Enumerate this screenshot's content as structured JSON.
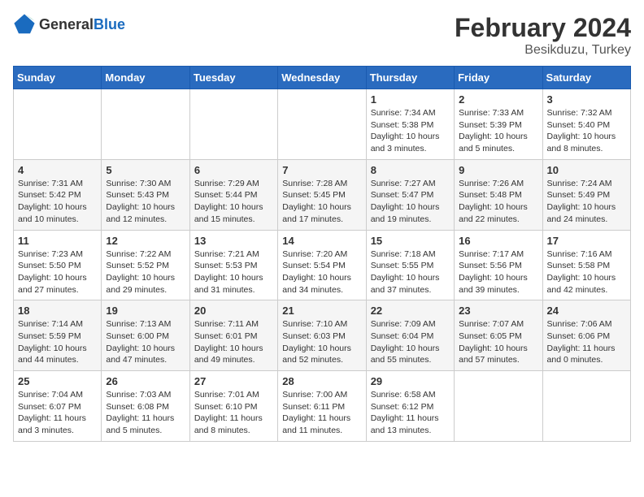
{
  "logo": {
    "general": "General",
    "blue": "Blue"
  },
  "header": {
    "month": "February 2024",
    "location": "Besikduzu, Turkey"
  },
  "weekdays": [
    "Sunday",
    "Monday",
    "Tuesday",
    "Wednesday",
    "Thursday",
    "Friday",
    "Saturday"
  ],
  "weeks": [
    [
      {
        "day": "",
        "info": ""
      },
      {
        "day": "",
        "info": ""
      },
      {
        "day": "",
        "info": ""
      },
      {
        "day": "",
        "info": ""
      },
      {
        "day": "1",
        "info": "Sunrise: 7:34 AM\nSunset: 5:38 PM\nDaylight: 10 hours\nand 3 minutes."
      },
      {
        "day": "2",
        "info": "Sunrise: 7:33 AM\nSunset: 5:39 PM\nDaylight: 10 hours\nand 5 minutes."
      },
      {
        "day": "3",
        "info": "Sunrise: 7:32 AM\nSunset: 5:40 PM\nDaylight: 10 hours\nand 8 minutes."
      }
    ],
    [
      {
        "day": "4",
        "info": "Sunrise: 7:31 AM\nSunset: 5:42 PM\nDaylight: 10 hours\nand 10 minutes."
      },
      {
        "day": "5",
        "info": "Sunrise: 7:30 AM\nSunset: 5:43 PM\nDaylight: 10 hours\nand 12 minutes."
      },
      {
        "day": "6",
        "info": "Sunrise: 7:29 AM\nSunset: 5:44 PM\nDaylight: 10 hours\nand 15 minutes."
      },
      {
        "day": "7",
        "info": "Sunrise: 7:28 AM\nSunset: 5:45 PM\nDaylight: 10 hours\nand 17 minutes."
      },
      {
        "day": "8",
        "info": "Sunrise: 7:27 AM\nSunset: 5:47 PM\nDaylight: 10 hours\nand 19 minutes."
      },
      {
        "day": "9",
        "info": "Sunrise: 7:26 AM\nSunset: 5:48 PM\nDaylight: 10 hours\nand 22 minutes."
      },
      {
        "day": "10",
        "info": "Sunrise: 7:24 AM\nSunset: 5:49 PM\nDaylight: 10 hours\nand 24 minutes."
      }
    ],
    [
      {
        "day": "11",
        "info": "Sunrise: 7:23 AM\nSunset: 5:50 PM\nDaylight: 10 hours\nand 27 minutes."
      },
      {
        "day": "12",
        "info": "Sunrise: 7:22 AM\nSunset: 5:52 PM\nDaylight: 10 hours\nand 29 minutes."
      },
      {
        "day": "13",
        "info": "Sunrise: 7:21 AM\nSunset: 5:53 PM\nDaylight: 10 hours\nand 31 minutes."
      },
      {
        "day": "14",
        "info": "Sunrise: 7:20 AM\nSunset: 5:54 PM\nDaylight: 10 hours\nand 34 minutes."
      },
      {
        "day": "15",
        "info": "Sunrise: 7:18 AM\nSunset: 5:55 PM\nDaylight: 10 hours\nand 37 minutes."
      },
      {
        "day": "16",
        "info": "Sunrise: 7:17 AM\nSunset: 5:56 PM\nDaylight: 10 hours\nand 39 minutes."
      },
      {
        "day": "17",
        "info": "Sunrise: 7:16 AM\nSunset: 5:58 PM\nDaylight: 10 hours\nand 42 minutes."
      }
    ],
    [
      {
        "day": "18",
        "info": "Sunrise: 7:14 AM\nSunset: 5:59 PM\nDaylight: 10 hours\nand 44 minutes."
      },
      {
        "day": "19",
        "info": "Sunrise: 7:13 AM\nSunset: 6:00 PM\nDaylight: 10 hours\nand 47 minutes."
      },
      {
        "day": "20",
        "info": "Sunrise: 7:11 AM\nSunset: 6:01 PM\nDaylight: 10 hours\nand 49 minutes."
      },
      {
        "day": "21",
        "info": "Sunrise: 7:10 AM\nSunset: 6:03 PM\nDaylight: 10 hours\nand 52 minutes."
      },
      {
        "day": "22",
        "info": "Sunrise: 7:09 AM\nSunset: 6:04 PM\nDaylight: 10 hours\nand 55 minutes."
      },
      {
        "day": "23",
        "info": "Sunrise: 7:07 AM\nSunset: 6:05 PM\nDaylight: 10 hours\nand 57 minutes."
      },
      {
        "day": "24",
        "info": "Sunrise: 7:06 AM\nSunset: 6:06 PM\nDaylight: 11 hours\nand 0 minutes."
      }
    ],
    [
      {
        "day": "25",
        "info": "Sunrise: 7:04 AM\nSunset: 6:07 PM\nDaylight: 11 hours\nand 3 minutes."
      },
      {
        "day": "26",
        "info": "Sunrise: 7:03 AM\nSunset: 6:08 PM\nDaylight: 11 hours\nand 5 minutes."
      },
      {
        "day": "27",
        "info": "Sunrise: 7:01 AM\nSunset: 6:10 PM\nDaylight: 11 hours\nand 8 minutes."
      },
      {
        "day": "28",
        "info": "Sunrise: 7:00 AM\nSunset: 6:11 PM\nDaylight: 11 hours\nand 11 minutes."
      },
      {
        "day": "29",
        "info": "Sunrise: 6:58 AM\nSunset: 6:12 PM\nDaylight: 11 hours\nand 13 minutes."
      },
      {
        "day": "",
        "info": ""
      },
      {
        "day": "",
        "info": ""
      }
    ]
  ]
}
